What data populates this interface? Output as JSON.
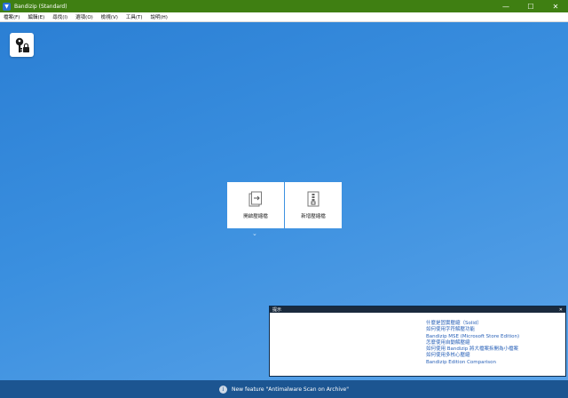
{
  "window": {
    "title": "Bandizip (Standard)",
    "controls": {
      "minimize": "—",
      "maximize": "☐",
      "close": "✕"
    }
  },
  "menu": {
    "items": [
      {
        "label": "檔案(F)"
      },
      {
        "label": "編輯(E)"
      },
      {
        "label": "尋找(I)"
      },
      {
        "label": "選項(O)"
      },
      {
        "label": "檢視(V)"
      },
      {
        "label": "工具(T)"
      },
      {
        "label": "說明(H)"
      }
    ]
  },
  "actions": {
    "open_archive": "開啟壓縮檔",
    "new_archive": "新增壓縮檔",
    "expand": "⌄"
  },
  "tips": {
    "header": "提示",
    "close": "✕",
    "links": [
      "什麼是固實壓縮（Solid）",
      "如何使用字符解壓功能",
      "Bandizip MSE (Microsoft Store Edition)",
      "怎麼使用自動解壓縮",
      "如何使用 Bandizip 將大檔案拆開為小檔案",
      "如何使用多核心壓縮",
      "Bandizip Edition Comparison"
    ]
  },
  "status": {
    "info_glyph": "i",
    "message": "New feature \"Antimalware Scan on Archive\""
  },
  "colors": {
    "titlebar": "#3f7f12",
    "workarea": "#2f86d6",
    "statusbar": "#1c5591",
    "link": "#2a62b8"
  }
}
